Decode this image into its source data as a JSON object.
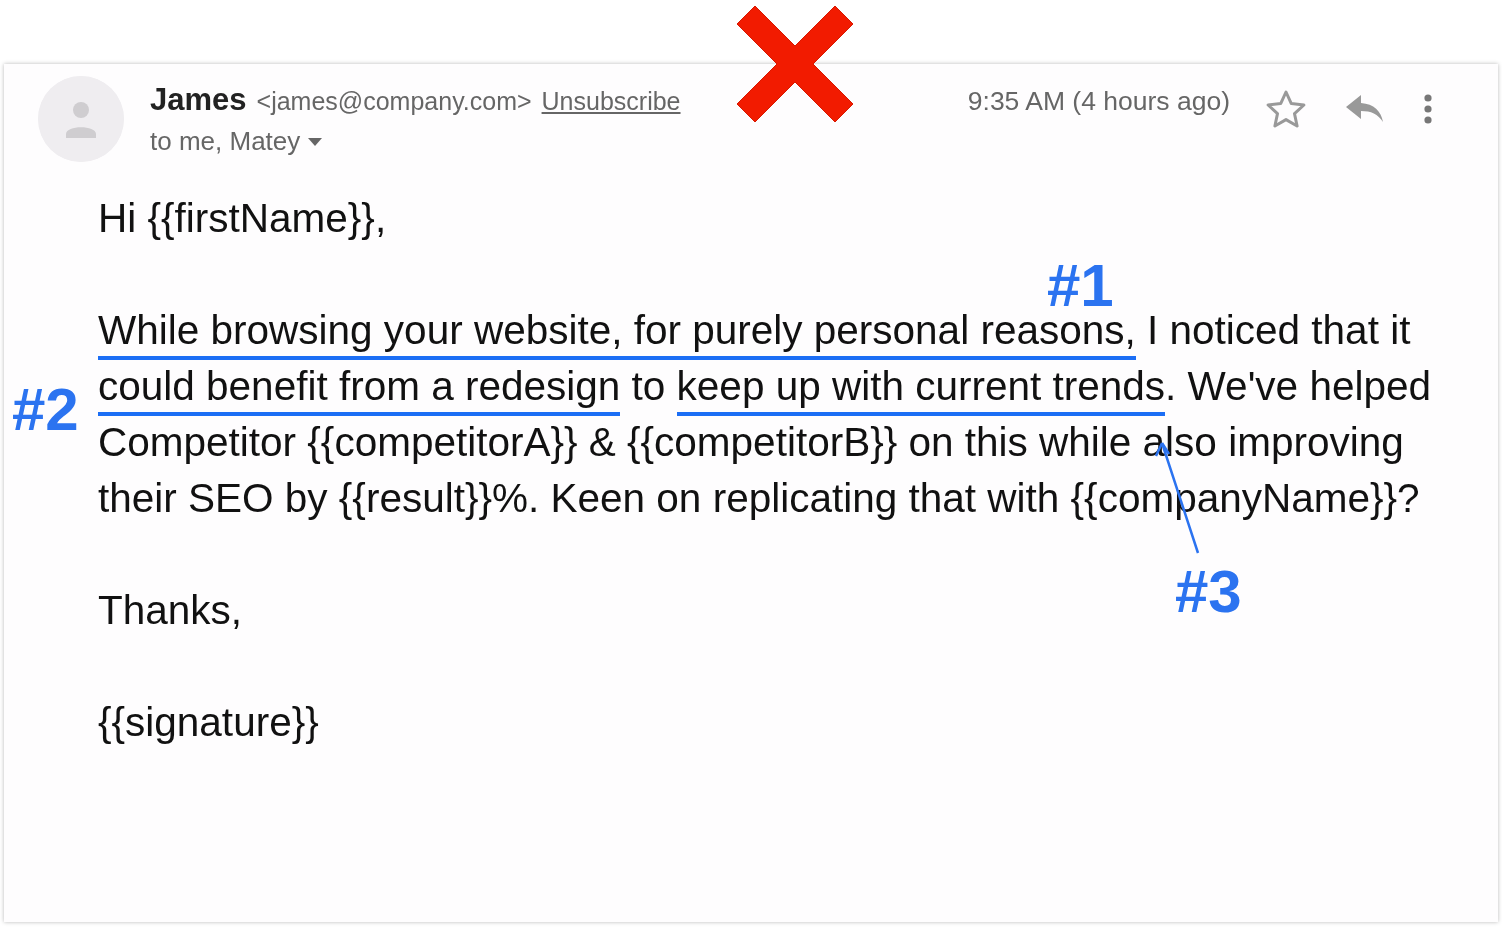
{
  "email": {
    "sender": {
      "name": "James",
      "address": "<james@company.com>",
      "unsubscribe": "Unsubscribe"
    },
    "recipients": "to me, Matey",
    "time": "9:35 AM (4 hours ago)",
    "starred": false,
    "body": {
      "greeting": "Hi {{firstName}},",
      "paragraph": [
        {
          "text": "While browsing your website, for purely personal reasons,",
          "underlined": true
        },
        {
          "text": " I noticed that it ",
          "underlined": false
        },
        {
          "text": "could benefit from a redesign",
          "underlined": true
        },
        {
          "text": " to ",
          "underlined": false
        },
        {
          "text": "keep up with current trends",
          "underlined": true
        },
        {
          "text": ". We've helped Competitor {{competitorA}} & {{competitorB}} on this while also improving their SEO by {{result}}%. Keen on replicating that with {{companyName}}?",
          "underlined": false
        }
      ],
      "closing": "Thanks,",
      "signature": "{{signature}}"
    }
  },
  "annotations": [
    "#1",
    "#2",
    "#3"
  ]
}
